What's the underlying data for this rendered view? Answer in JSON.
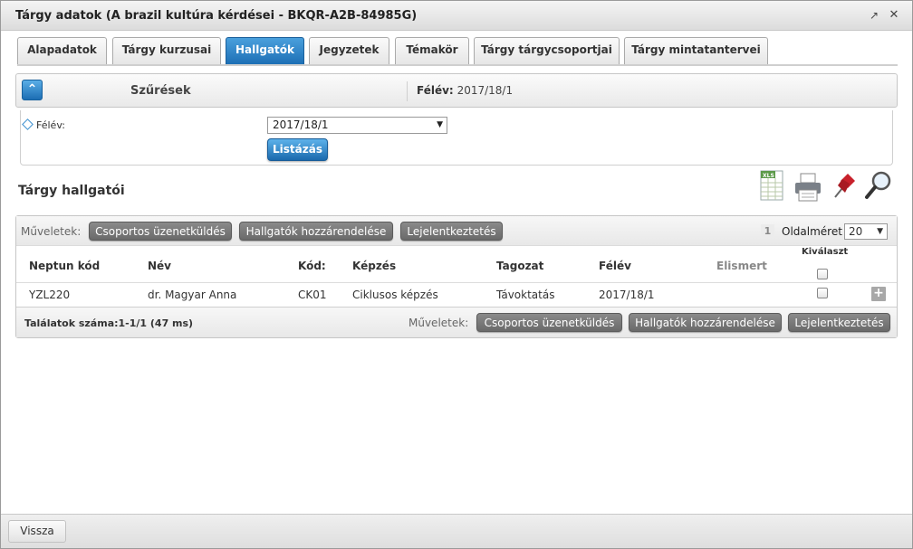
{
  "window": {
    "title": "Tárgy adatok (A brazil kultúra kérdései - BKQR-A2B-84985G)",
    "popout_icon": "external-link-icon",
    "close_icon": "close-icon"
  },
  "tabs": [
    {
      "label": "Alapadatok"
    },
    {
      "label": "Tárgy kurzusai"
    },
    {
      "label": "Hallgatók"
    },
    {
      "label": "Jegyzetek"
    },
    {
      "label": "Témakör"
    },
    {
      "label": "Tárgy tárgycsoportjai"
    },
    {
      "label": "Tárgy mintatantervei"
    }
  ],
  "active_tab": "Hallgatók",
  "filter": {
    "title": "Szűrések",
    "semester_label": "Félév:",
    "semester_value": "2017/18/1",
    "field_label": "Félév:",
    "select_value": "2017/18/1",
    "list_button": "Listázás"
  },
  "section": {
    "title": "Tárgy hallgatói",
    "icons": [
      "xls-export-icon",
      "print-icon",
      "pin-icon",
      "search-magnifier-icon"
    ]
  },
  "grid": {
    "ops_label": "Műveletek:",
    "actions": [
      "Csoportos üzenetküldés",
      "Hallgatók hozzárendelése",
      "Lejelentkeztetés"
    ],
    "page": "1",
    "page_size_label": "Oldalméret",
    "page_size": "20",
    "select_header": "Kiválaszt",
    "columns": [
      "Neptun kód",
      "Név",
      "Kód:",
      "Képzés",
      "Tagozat",
      "Félév",
      "Elismert"
    ],
    "rows": [
      {
        "neptun": "YZL220",
        "name": "dr. Magyar Anna",
        "code": "CK01",
        "training": "Ciklusos képzés",
        "mode": "Távoktatás",
        "semester": "2017/18/1",
        "accepted": ""
      }
    ],
    "results": "Találatok száma:1-1/1 (47 ms)"
  },
  "footer": {
    "back_button": "Vissza"
  },
  "colors": {
    "accent_blue": "#1d6fb5",
    "button_gray": "#7a7a7a"
  }
}
